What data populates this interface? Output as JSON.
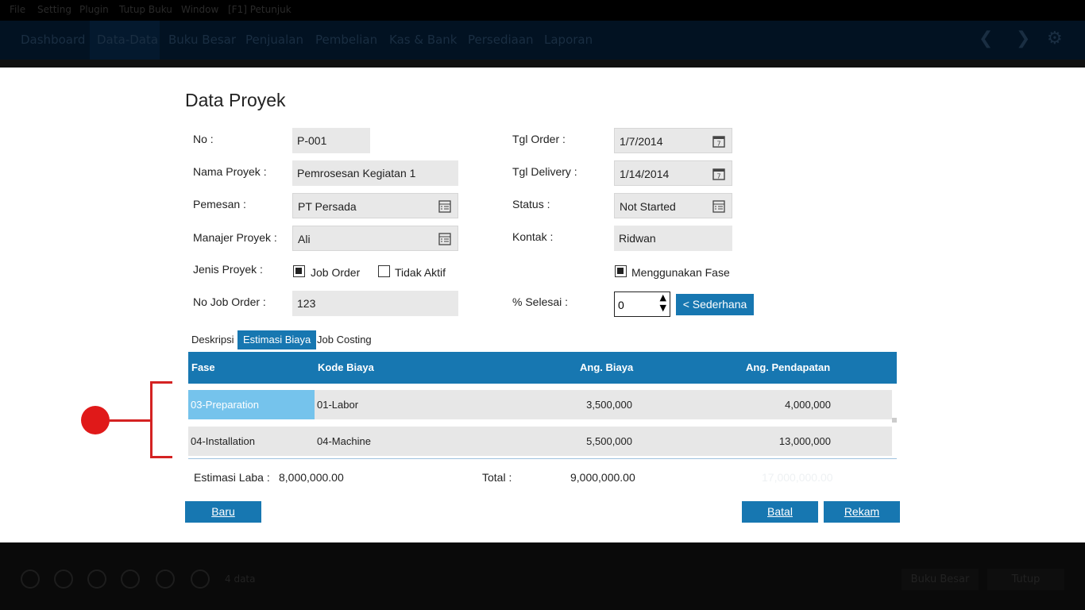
{
  "menu": [
    "File",
    "Setting",
    "Plugin",
    "Tutup Buku",
    "Window",
    "[F1] Petunjuk"
  ],
  "nav": [
    "Dashboard",
    "Data-Data",
    "Buku Besar",
    "Penjualan",
    "Pembelian",
    "Kas & Bank",
    "Persediaan",
    "Laporan"
  ],
  "form": {
    "title": "Data Proyek",
    "no_label": "No :",
    "no_value": "P-001",
    "nama_label": "Nama Proyek :",
    "nama_value": "Pemrosesan Kegiatan 1",
    "pemesan_label": "Pemesan :",
    "pemesan_value": "PT Persada",
    "manajer_label": "Manajer Proyek :",
    "manajer_value": "Ali",
    "jenis_label": "Jenis Proyek :",
    "job_order_label": "Job Order",
    "tidak_aktif_label": "Tidak Aktif",
    "nojob_label": "No Job Order :",
    "nojob_value": "123",
    "tgl_order_label": "Tgl Order :",
    "tgl_order_value": "1/7/2014",
    "tgl_delivery_label": "Tgl Delivery :",
    "tgl_delivery_value": "1/14/2014",
    "status_label": "Status :",
    "status_value": "Not Started",
    "kontak_label": "Kontak :",
    "kontak_value": "Ridwan",
    "fase_label": "Menggunakan Fase",
    "selesai_label": "% Selesai :",
    "selesai_value": "0",
    "sederhana_label": "< Sederhana"
  },
  "tabs": [
    "Deskripsi",
    "Estimasi Biaya",
    "Job Costing"
  ],
  "table": {
    "headers": [
      "Fase",
      "Kode Biaya",
      "Ang. Biaya",
      "Ang. Pendapatan"
    ],
    "rows": [
      [
        "03-Preparation",
        "01-Labor",
        "3,500,000",
        "4,000,000"
      ],
      [
        "04-Installation",
        "04-Machine",
        "5,500,000",
        "13,000,000"
      ]
    ]
  },
  "summary": {
    "laba_label": "Estimasi Laba :",
    "laba_value": "8,000,000.00",
    "total_label": "Total :",
    "total_biaya": "9,000,000.00",
    "total_pendapatan": "17,000,000.00"
  },
  "buttons": {
    "baru": "Baru",
    "batal": "Batal",
    "rekam": "Rekam"
  },
  "bottom": {
    "count": "4 data",
    "buku_besar": "Buku Besar",
    "tutup": "Tutup"
  },
  "colors": {
    "accent": "#1777b1",
    "selected_row": "#75c3ec",
    "annotation": "#e01919"
  }
}
